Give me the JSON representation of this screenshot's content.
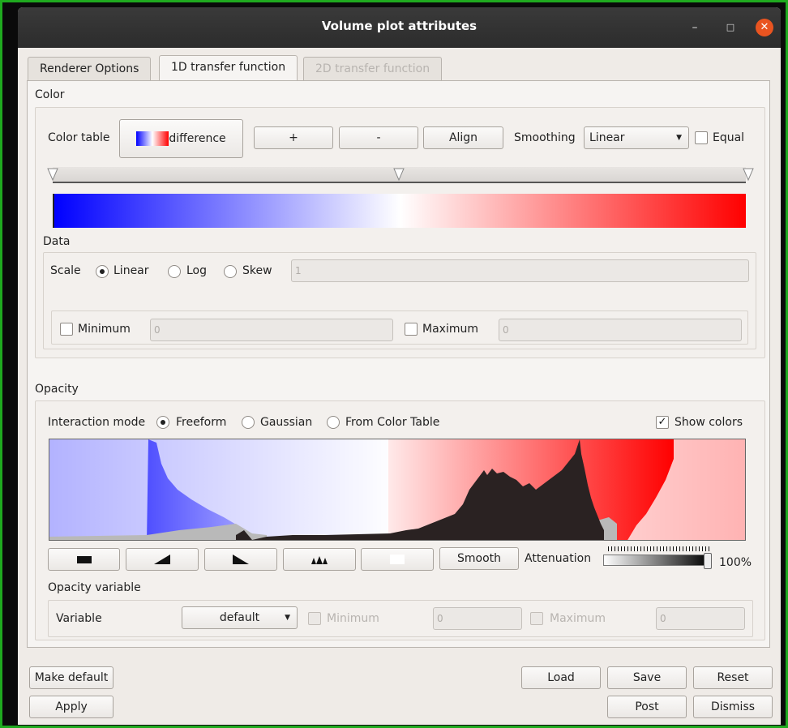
{
  "window": {
    "title": "Volume plot attributes",
    "minimize": "–",
    "maximize": "□",
    "close": "✕"
  },
  "tabs": [
    {
      "label": "Renderer Options",
      "state": "normal"
    },
    {
      "label": "1D transfer function",
      "state": "active"
    },
    {
      "label": "2D transfer function",
      "state": "disabled"
    }
  ],
  "color": {
    "section_label": "Color",
    "color_table_label": "Color table",
    "color_table_value": "difference",
    "add_button": "+",
    "remove_button": "-",
    "align_button": "Align",
    "smoothing_label": "Smoothing",
    "smoothing_value": "Linear",
    "equal_label": "Equal",
    "equal_checked": false,
    "gradient_colors": [
      "#0000ff",
      "#ffffff",
      "#ff0000"
    ]
  },
  "data": {
    "section_label": "Data",
    "scale_label": "Scale",
    "scale_options": [
      "Linear",
      "Log",
      "Skew"
    ],
    "scale_selected": "Linear",
    "skew_value": "1",
    "minimum_label": "Minimum",
    "minimum_checked": false,
    "minimum_value": "0",
    "maximum_label": "Maximum",
    "maximum_checked": false,
    "maximum_value": "0"
  },
  "opacity": {
    "section_label": "Opacity",
    "interaction_mode_label": "Interaction mode",
    "modes": [
      "Freeform",
      "Gaussian",
      "From Color Table"
    ],
    "mode_selected": "Freeform",
    "show_colors_label": "Show colors",
    "show_colors_checked": true,
    "shape_buttons": [
      "ramp-flat-icon",
      "ramp-up-icon",
      "ramp-down-icon",
      "ramp-spikes-icon",
      "ramp-white-icon"
    ],
    "smooth_button": "Smooth",
    "attenuation_label": "Attenuation",
    "attenuation_value": "100%",
    "attenuation_level": 1.0,
    "variable_section_label": "Opacity variable",
    "variable_label": "Variable",
    "variable_value": "default",
    "var_minimum_label": "Minimum",
    "var_minimum_value": "0",
    "var_maximum_label": "Maximum",
    "var_maximum_value": "0"
  },
  "footer": {
    "make_default": "Make default",
    "apply": "Apply",
    "load": "Load",
    "save": "Save",
    "reset": "Reset",
    "post": "Post",
    "dismiss": "Dismiss"
  }
}
